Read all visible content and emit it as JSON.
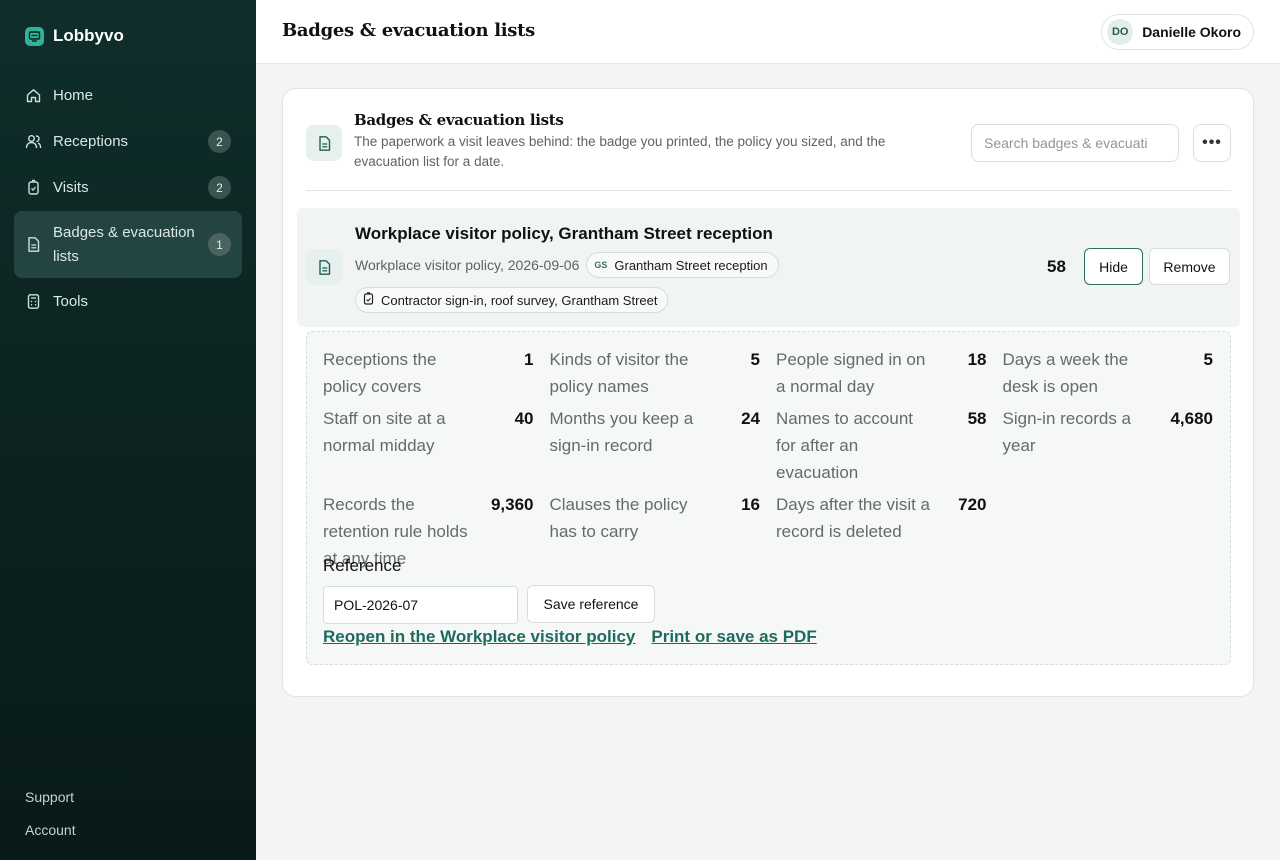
{
  "app": {
    "name": "Lobbyvo"
  },
  "sidebar": {
    "items": [
      {
        "label": "Home",
        "icon": "home-icon",
        "count": ""
      },
      {
        "label": "Receptions",
        "icon": "people-icon",
        "count": "2"
      },
      {
        "label": "Visits",
        "icon": "badge-icon",
        "count": "2"
      },
      {
        "label": "Badges & evacuation lists",
        "icon": "document-icon",
        "count": "1",
        "active": true
      },
      {
        "label": "Tools",
        "icon": "calculator-icon",
        "count": ""
      }
    ],
    "footer": {
      "support": "Support",
      "account": "Account"
    }
  },
  "header": {
    "title": "Badges & evacuation lists",
    "user": {
      "initials": "DO",
      "name": "Danielle Okoro"
    }
  },
  "card": {
    "title": "Badges & evacuation lists",
    "description": "The paperwork a visit leaves behind: the badge you printed, the policy you sized, and the evacuation list for a date.",
    "search_placeholder": "Search badges & evacuati",
    "more_label": "•••"
  },
  "item": {
    "title": "Workplace visitor policy, Grantham Street reception",
    "subtitle": "Workplace visitor policy, 2026-09-06",
    "reception_chip": {
      "initials": "GS",
      "label": "Grantham Street reception"
    },
    "visit_chip": {
      "label": "Contractor sign-in, roof survey, Grantham Street"
    },
    "count": "58",
    "hide_label": "Hide",
    "remove_label": "Remove"
  },
  "stats": [
    {
      "label": "Receptions the policy covers",
      "value": "1"
    },
    {
      "label": "Kinds of visitor the policy names",
      "value": "5"
    },
    {
      "label": "People signed in on a normal day",
      "value": "18"
    },
    {
      "label": "Days a week the desk is open",
      "value": "5"
    },
    {
      "label": "Staff on site at a normal midday",
      "value": "40"
    },
    {
      "label": "Months you keep a sign-in record",
      "value": "24"
    },
    {
      "label": "Names to account for after an evacuation",
      "value": "58"
    },
    {
      "label": "Sign-in records a year",
      "value": "4,680"
    },
    {
      "label": "Records the retention rule holds at any time",
      "value": "9,360"
    },
    {
      "label": "Clauses the policy has to carry",
      "value": "16"
    },
    {
      "label": "Days after the visit a record is deleted",
      "value": "720"
    }
  ],
  "reference": {
    "label": "Reference",
    "value": "POL-2026-07",
    "save_label": "Save reference"
  },
  "links": {
    "reopen": "Reopen in the Workplace visitor policy",
    "print": "Print or save as PDF"
  },
  "colors": {
    "sidebar_bg": "#0c2422",
    "accent": "#1d6b5f",
    "brand": "#2fb39a"
  }
}
